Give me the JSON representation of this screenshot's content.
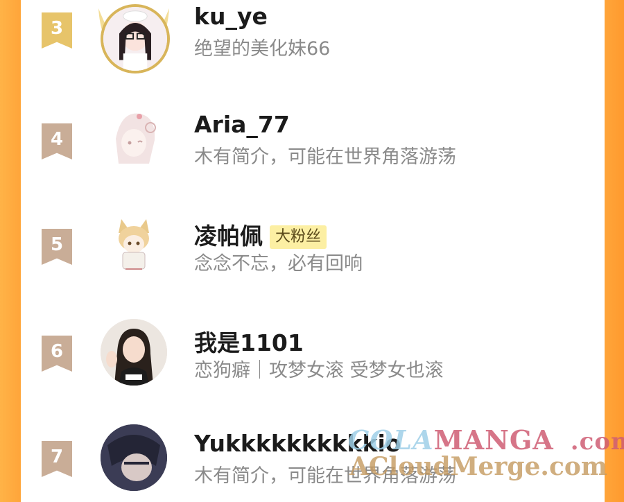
{
  "rankings": [
    {
      "rank": "3",
      "name": "ku_ye",
      "desc": "绝望的美化妹66",
      "badge": ""
    },
    {
      "rank": "4",
      "name": "Aria_77",
      "desc": "木有简介，可能在世界角落游荡",
      "badge": ""
    },
    {
      "rank": "5",
      "name": "凌帕佩",
      "desc": "念念不忘，必有回响",
      "badge": "大粉丝"
    },
    {
      "rank": "6",
      "name": "我是1101",
      "desc": "恋狗癖｜攻梦女滚 受梦女也滚",
      "badge": ""
    },
    {
      "rank": "7",
      "name": "Yukkkkkkkkkkio",
      "desc": "木有简介，可能在世界角落游荡",
      "badge": ""
    }
  ],
  "watermark": {
    "part1": "COLA",
    "part2": "MANGA",
    "part3": ".com",
    "line2": "ACloudMerge.com"
  },
  "colors": {
    "side_orange": "#ffa53a",
    "rank_gold": "#e7c46a",
    "rank_tan": "#c9ad97",
    "badge_bg": "#fcefa3"
  }
}
